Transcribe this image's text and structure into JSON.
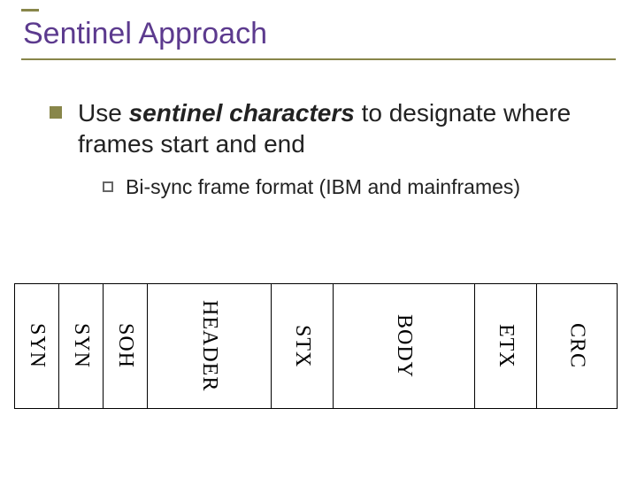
{
  "title": "Sentinel Approach",
  "bullet": {
    "pre": "Use ",
    "emph": "sentinel characters",
    "post": " to designate where frames start and end"
  },
  "sub": "Bi-sync frame format (IBM and mainframes)",
  "frame": {
    "cells": [
      "SYN",
      "SYN",
      "SOH",
      "HEADER",
      "STX",
      "BODY",
      "ETX",
      "CRC"
    ],
    "widths": [
      50,
      50,
      50,
      140,
      70,
      160,
      70,
      90
    ]
  }
}
